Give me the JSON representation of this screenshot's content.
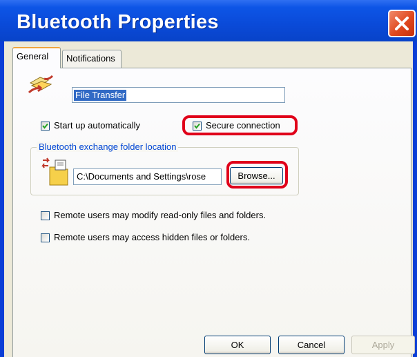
{
  "window": {
    "title": "Bluetooth Properties",
    "close_icon": "close-x-icon"
  },
  "tabs": [
    {
      "label": "General",
      "selected": true
    },
    {
      "label": "Notifications",
      "selected": false
    }
  ],
  "general": {
    "service_icon": "file-transfer-icon",
    "service_name": "File Transfer",
    "start_up_automatically": {
      "label": "Start up automatically",
      "checked": true
    },
    "secure_connection": {
      "label": "Secure connection",
      "checked": true
    },
    "folder_group": {
      "legend": "Bluetooth exchange folder location",
      "folder_icon": "exchange-folder-icon",
      "path": "C:\\Documents and Settings\\rose",
      "browse_label": "Browse..."
    },
    "remote_modify": {
      "label": "Remote users may modify read-only files and folders.",
      "checked": false
    },
    "remote_hidden": {
      "label": "Remote users may access hidden files or folders.",
      "checked": false
    }
  },
  "footer": {
    "ok_label": "OK",
    "cancel_label": "Cancel",
    "apply_label": "Apply"
  },
  "colors": {
    "title_bar": "#0a4ad8",
    "close_button": "#e0481e",
    "highlight_annotation": "#e0001a",
    "group_legend": "#0046d5"
  }
}
